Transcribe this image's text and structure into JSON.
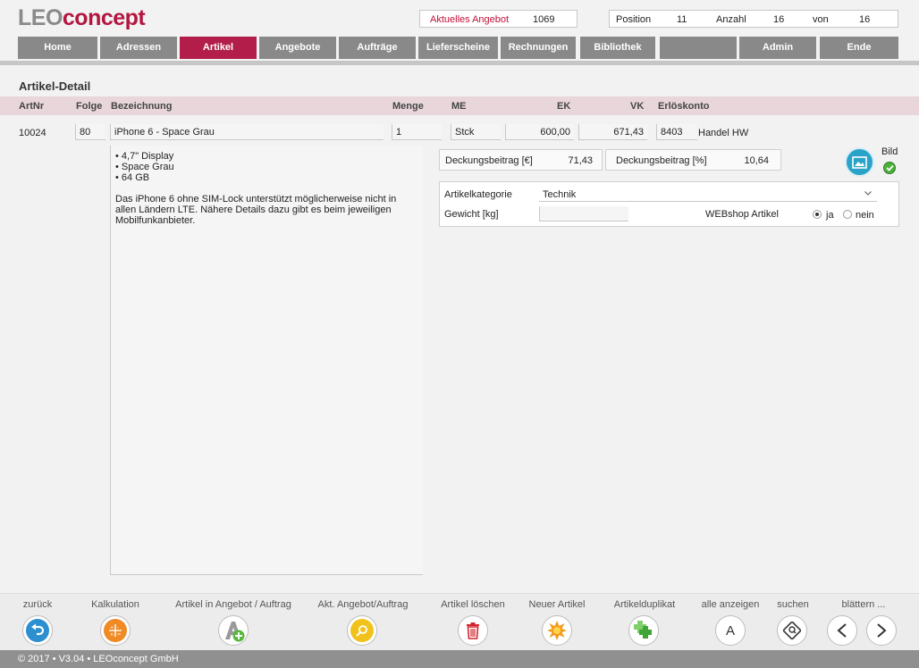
{
  "header": {
    "logo_part1": "LEO",
    "logo_part2": "concept",
    "current_offer_label": "Aktuelles Angebot",
    "current_offer_value": "1069",
    "position_label": "Position",
    "position_value": "11",
    "count_label": "Anzahl",
    "count_value": "16",
    "of_label": "von",
    "of_value": "16"
  },
  "nav": [
    "Home",
    "Adressen",
    "Artikel",
    "Angebote",
    "Aufträge",
    "Lieferscheine",
    "Rechnungen",
    "Bibliothek",
    "",
    "Admin",
    "Ende"
  ],
  "section_title": "Artikel-Detail",
  "columns": {
    "artnr": "ArtNr",
    "folge": "Folge",
    "bezeichnung": "Bezeichnung",
    "menge": "Menge",
    "me": "ME",
    "ek": "EK",
    "vk": "VK",
    "erloeskonto": "Erlöskonto"
  },
  "article": {
    "artnr": "10024",
    "folge": "80",
    "bezeichnung": "iPhone 6 - Space Grau",
    "menge": "1",
    "me": "Stck",
    "ek": "600,00",
    "vk": "671,43",
    "konto_nr": "8403",
    "konto_name": "Handel HW",
    "desc_bullets": [
      "• 4,7\" Display",
      "• Space Grau",
      "• 64 GB"
    ],
    "desc_text": "Das iPhone 6 ohne SIM-Lock unterstützt möglicherweise nicht in allen Ländern LTE. Nähere Details dazu gibt es beim jeweiligen Mobilfunkanbieter."
  },
  "margin": {
    "eur_label": "Deckungsbeitrag [€]",
    "eur_value": "71,43",
    "pct_label": "Deckungsbeitrag [%]",
    "pct_value": "10,64"
  },
  "image_label": "Bild",
  "details": {
    "category_label": "Artikelkategorie",
    "category_value": "Technik",
    "weight_label": "Gewicht [kg]",
    "weight_value": "",
    "webshop_label": "WEBshop Artikel",
    "yes_label": "ja",
    "no_label": "nein",
    "webshop_selected": "ja"
  },
  "footer": {
    "back": "zurück",
    "calc": "Kalkulation",
    "to_offer": "Artikel in Angebot / Auftrag",
    "current_offer": "Akt. Angebot/Auftrag",
    "delete": "Artikel löschen",
    "new": "Neuer Artikel",
    "duplicate": "Artikelduplikat",
    "show_all": "alle anzeigen",
    "search": "suchen",
    "browse": "blättern ...",
    "show_all_icon_letter": "A",
    "copyright": "© 2017 • V3.04 • LEOconcept GmbH"
  },
  "colors": {
    "brand": "#b3163f",
    "nav": "#898989",
    "nav_active": "#b21e49",
    "header_row": "#e8d6db"
  }
}
